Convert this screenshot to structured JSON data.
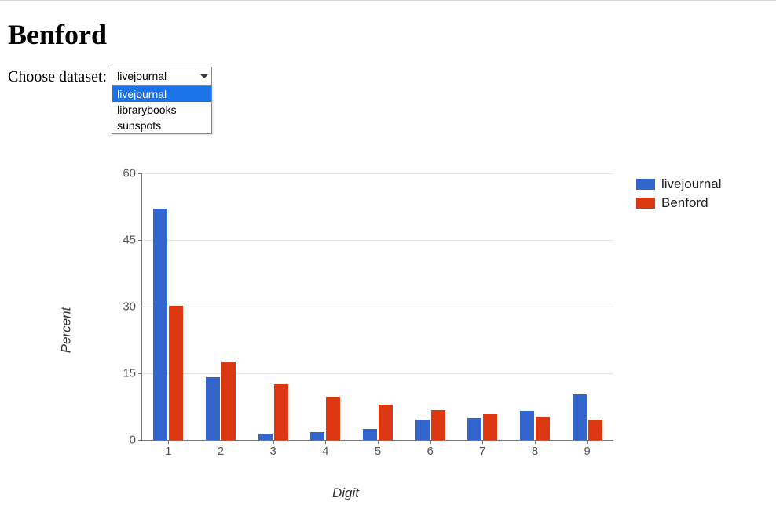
{
  "title": "Benford",
  "controls": {
    "label": "Choose dataset:",
    "selected": "livejournal",
    "options": [
      "livejournal",
      "librarybooks",
      "sunspots"
    ]
  },
  "chart_data": {
    "type": "bar",
    "xlabel": "Digit",
    "ylabel": "Percent",
    "categories": [
      "1",
      "2",
      "3",
      "4",
      "5",
      "6",
      "7",
      "8",
      "9"
    ],
    "series": [
      {
        "name": "livejournal",
        "values": [
          52.0,
          14.2,
          1.5,
          1.8,
          2.5,
          4.6,
          5.0,
          6.5,
          10.2
        ]
      },
      {
        "name": "Benford",
        "values": [
          30.1,
          17.6,
          12.5,
          9.7,
          7.9,
          6.7,
          5.8,
          5.1,
          4.6
        ]
      }
    ],
    "ylim": [
      0,
      60
    ],
    "yticks": [
      0,
      15,
      30,
      45,
      60
    ],
    "colors": [
      "#3366cc",
      "#dc3912"
    ]
  }
}
